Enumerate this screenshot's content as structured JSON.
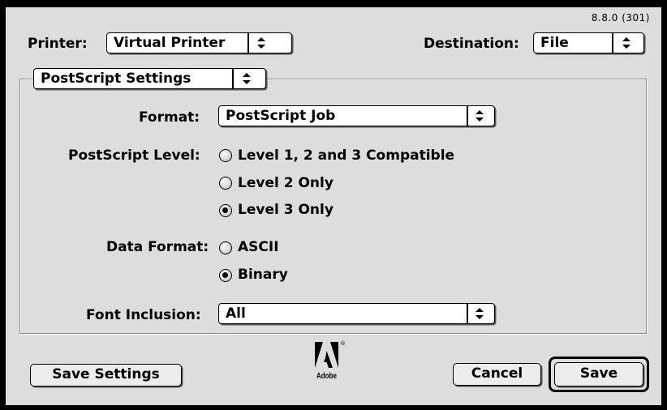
{
  "version": "8.8.0 (301)",
  "header": {
    "printer_label": "Printer:",
    "printer_value": "Virtual Printer",
    "destination_label": "Destination:",
    "destination_value": "File"
  },
  "panel_popup": "PostScript Settings",
  "format": {
    "label": "Format:",
    "value": "PostScript Job"
  },
  "postscript_level": {
    "label": "PostScript Level:",
    "options": [
      {
        "label": "Level 1, 2 and 3 Compatible",
        "selected": false
      },
      {
        "label": "Level 2 Only",
        "selected": false
      },
      {
        "label": "Level 3 Only",
        "selected": true
      }
    ]
  },
  "data_format": {
    "label": "Data Format:",
    "options": [
      {
        "label": "ASCII",
        "selected": false
      },
      {
        "label": "Binary",
        "selected": true
      }
    ]
  },
  "font_inclusion": {
    "label": "Font Inclusion:",
    "value": "All"
  },
  "buttons": {
    "save_settings": "Save Settings",
    "cancel": "Cancel",
    "save": "Save"
  },
  "logo": {
    "text": "Adobe",
    "mark": "®"
  }
}
